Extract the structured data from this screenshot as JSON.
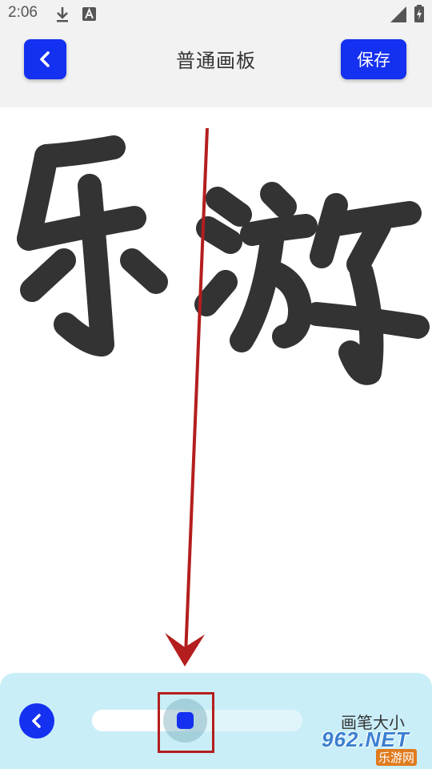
{
  "status_bar": {
    "time": "2:06",
    "left_icons": [
      "download-icon",
      "app-a-icon"
    ],
    "right_icons": [
      "signal-icon",
      "battery-icon"
    ]
  },
  "header": {
    "back_icon": "chevron-left-icon",
    "title": "普通画板",
    "save_label": "保存"
  },
  "canvas": {
    "background": "#ffffff",
    "stroke_color": "#333333",
    "drawn_characters": "乐游"
  },
  "bottom_panel": {
    "back_icon": "chevron-left-icon",
    "brush_size_label": "画笔大小",
    "brush_size_level": 0.44
  },
  "annotation": {
    "arrow_color": "#b41e1e",
    "box_color": "#b41e1e"
  },
  "watermark": {
    "number": "962.NET",
    "subtitle": "乐游网"
  },
  "colors": {
    "accent": "#1430f0",
    "panel": "#c9eef8",
    "bar": "#f2f2f2"
  }
}
